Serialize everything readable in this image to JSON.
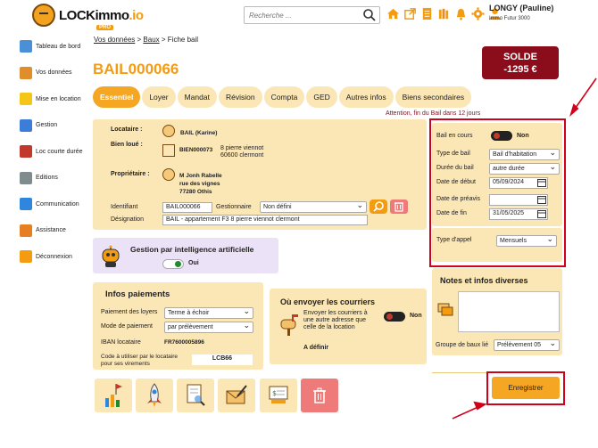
{
  "app": {
    "logo_text": "LOCKimmo",
    "logo_suffix": ".io",
    "logo_badge": "PRO"
  },
  "search": {
    "placeholder": "Recherche ..."
  },
  "user": {
    "name": "LONGY (Pauline)",
    "company": "Immo Futur 3000"
  },
  "sidebar": {
    "items": [
      {
        "label": "Tableau de bord",
        "icon": "dashboard-icon",
        "color": "#4a90d9"
      },
      {
        "label": "Vos données",
        "icon": "person-icon",
        "color": "#e08e2b"
      },
      {
        "label": "Mise en location",
        "icon": "key-icon",
        "color": "#f5c518"
      },
      {
        "label": "Gestion",
        "icon": "management-icon",
        "color": "#3b7dd8"
      },
      {
        "label": "Loc courte durée",
        "icon": "suitcase-icon",
        "color": "#c0392b"
      },
      {
        "label": "Editions",
        "icon": "chart-icon",
        "color": "#7f8c8d"
      },
      {
        "label": "Communication",
        "icon": "chat-icon",
        "color": "#2e86de"
      },
      {
        "label": "Assistance",
        "icon": "support-icon",
        "color": "#e67e22"
      },
      {
        "label": "Déconnexion",
        "icon": "logout-icon",
        "color": "#f39c12"
      }
    ]
  },
  "breadcrumb": {
    "item1": "Vos données",
    "sep": ">",
    "item2": "Baux",
    "item3": "Fiche bail"
  },
  "page": {
    "title": "BAIL000066"
  },
  "solde": {
    "label": "SOLDE",
    "value": "-1295 €",
    "color": "#8b0d1c"
  },
  "tabs": [
    "Essentiel",
    "Loyer",
    "Mandat",
    "Révision",
    "Compta",
    "GED",
    "Autres infos",
    "Biens secondaires"
  ],
  "attention": "Attention, fin du Bail dans 12 jours",
  "lease": {
    "locataire_label": "Locataire :",
    "locataire_value": "BAIL (Karine)",
    "bien_label": "Bien loué :",
    "bien_ref": "BIEN000073",
    "bien_addr1": "8 pierre viennot",
    "bien_addr2": "60600 clermont",
    "proprio_label": "Propriétaire :",
    "proprio_name": "M Jonh Rabelle",
    "proprio_addr1": "rue des vignes",
    "proprio_addr2": "77280 Othis",
    "identifiant_label": "Identifiant",
    "identifiant_value": "BAIL000066",
    "gestionnaire_label": "Gestionnaire",
    "gestionnaire_value": "Non défini",
    "designation_label": "Désignation",
    "designation_value": "BAIL - appartement F3 8 pierre viennot clermont"
  },
  "ai": {
    "title": "Gestion par intelligence artificielle",
    "toggle_label": "Oui"
  },
  "payments": {
    "title": "Infos paiements",
    "paiement_label": "Paiement des loyers",
    "paiement_value": "Terme à échoir",
    "mode_label": "Mode de paiement",
    "mode_value": "par prélèvement",
    "iban_label": "IBAN locataire",
    "iban_value": "FR7600005896",
    "code_label1": "Code à utiliser par le locataire",
    "code_label2": "pour ses virements",
    "code_value": "LCB66"
  },
  "mail": {
    "title": "Où envoyer les courriers",
    "desc1": "Envoyer les courriers à",
    "desc2": "une autre adresse que",
    "desc3": "celle de la location",
    "toggle_label": "Non",
    "address": "A définir"
  },
  "right": {
    "bail_en_cours_label": "Bail en cours",
    "bail_en_cours_value": "Non",
    "type_label": "Type de bail",
    "type_value": "Bail d'habitation",
    "duree_label": "Durée du bail",
    "duree_value": "autre durée",
    "debut_label": "Date de début",
    "debut_value": "05/09/2024",
    "preavis_label": "Date de préavis",
    "preavis_value": "",
    "fin_label": "Date de fin",
    "fin_value": "31/05/2025",
    "appel_label": "Type d'appel",
    "appel_value": "Mensuels"
  },
  "notes": {
    "title": "Notes et infos diverses",
    "groupe_label": "Groupe de baux lié",
    "groupe_value": "Prélèvement 05"
  },
  "actions": {
    "save_label": "Enregistrer"
  },
  "colors": {
    "accent": "#f5a623",
    "panel": "#fbe6b5",
    "annotation": "#d0021b"
  }
}
